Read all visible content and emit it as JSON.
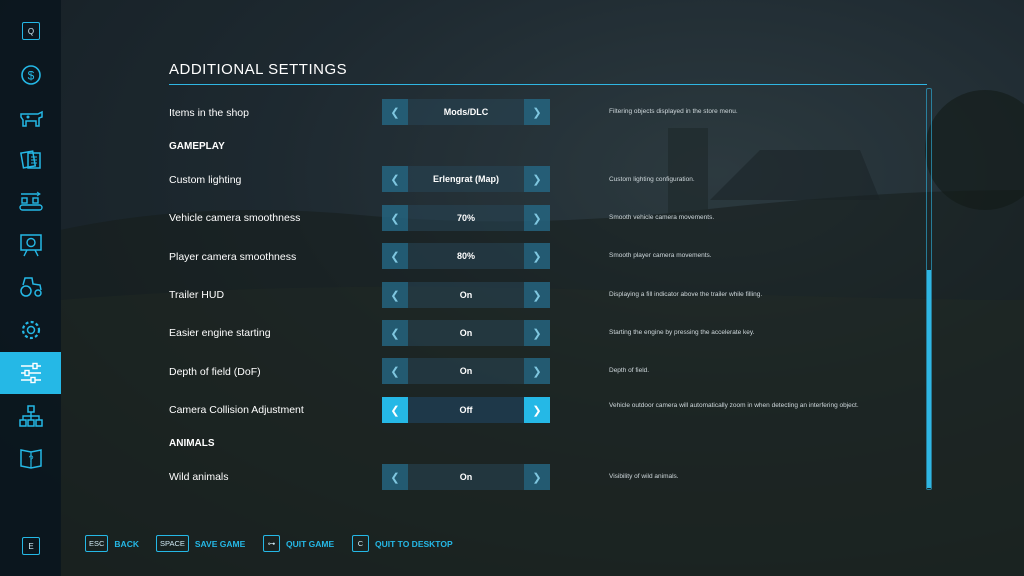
{
  "sidebar": {
    "top_key": "Q",
    "bottom_key": "E",
    "items": [
      {
        "icon": "dollar-icon"
      },
      {
        "icon": "cow-icon"
      },
      {
        "icon": "contracts-icon"
      },
      {
        "icon": "production-icon"
      },
      {
        "icon": "stats-icon"
      },
      {
        "icon": "vehicles-icon"
      },
      {
        "icon": "gear-icon"
      },
      {
        "icon": "settings-sliders-icon",
        "active": true
      },
      {
        "icon": "hierarchy-icon"
      },
      {
        "icon": "help-book-icon"
      }
    ]
  },
  "page": {
    "title": "ADDITIONAL SETTINGS"
  },
  "settings": {
    "items_shop": {
      "label": "Items in the shop",
      "value": "Mods/DLC",
      "desc": "Filtering objects displayed in the store menu."
    },
    "section_gameplay": "GAMEPLAY",
    "custom_lighting": {
      "label": "Custom lighting",
      "value": "Erlengrat (Map)",
      "desc": "Custom lighting configuration."
    },
    "vehicle_cam": {
      "label": "Vehicle camera smoothness",
      "value": "70%",
      "desc": "Smooth vehicle camera movements."
    },
    "player_cam": {
      "label": "Player camera smoothness",
      "value": "80%",
      "desc": "Smooth player camera movements."
    },
    "trailer_hud": {
      "label": "Trailer HUD",
      "value": "On",
      "desc": "Displaying a fill indicator above the trailer while filling."
    },
    "engine_start": {
      "label": "Easier engine starting",
      "value": "On",
      "desc": "Starting the engine by pressing the accelerate key."
    },
    "dof": {
      "label": "Depth of field (DoF)",
      "value": "On",
      "desc": "Depth of field."
    },
    "cam_collision": {
      "label": "Camera Collision Adjustment",
      "value": "Off",
      "desc": "Vehicle outdoor camera will automatically zoom in when detecting an interfering object."
    },
    "section_animals": "ANIMALS",
    "wild_animals": {
      "label": "Wild animals",
      "value": "On",
      "desc": "Visibility of wild animals."
    }
  },
  "footer": {
    "back": {
      "key": "ESC",
      "label": "BACK"
    },
    "save": {
      "key": "SPACE",
      "label": "SAVE GAME"
    },
    "quit": {
      "key": "⊶",
      "label": "QUIT GAME"
    },
    "desktop": {
      "key": "C",
      "label": "QUIT TO DESKTOP"
    }
  },
  "colors": {
    "accent": "#25b8e6",
    "sidebar_bg": "#0a161e"
  }
}
